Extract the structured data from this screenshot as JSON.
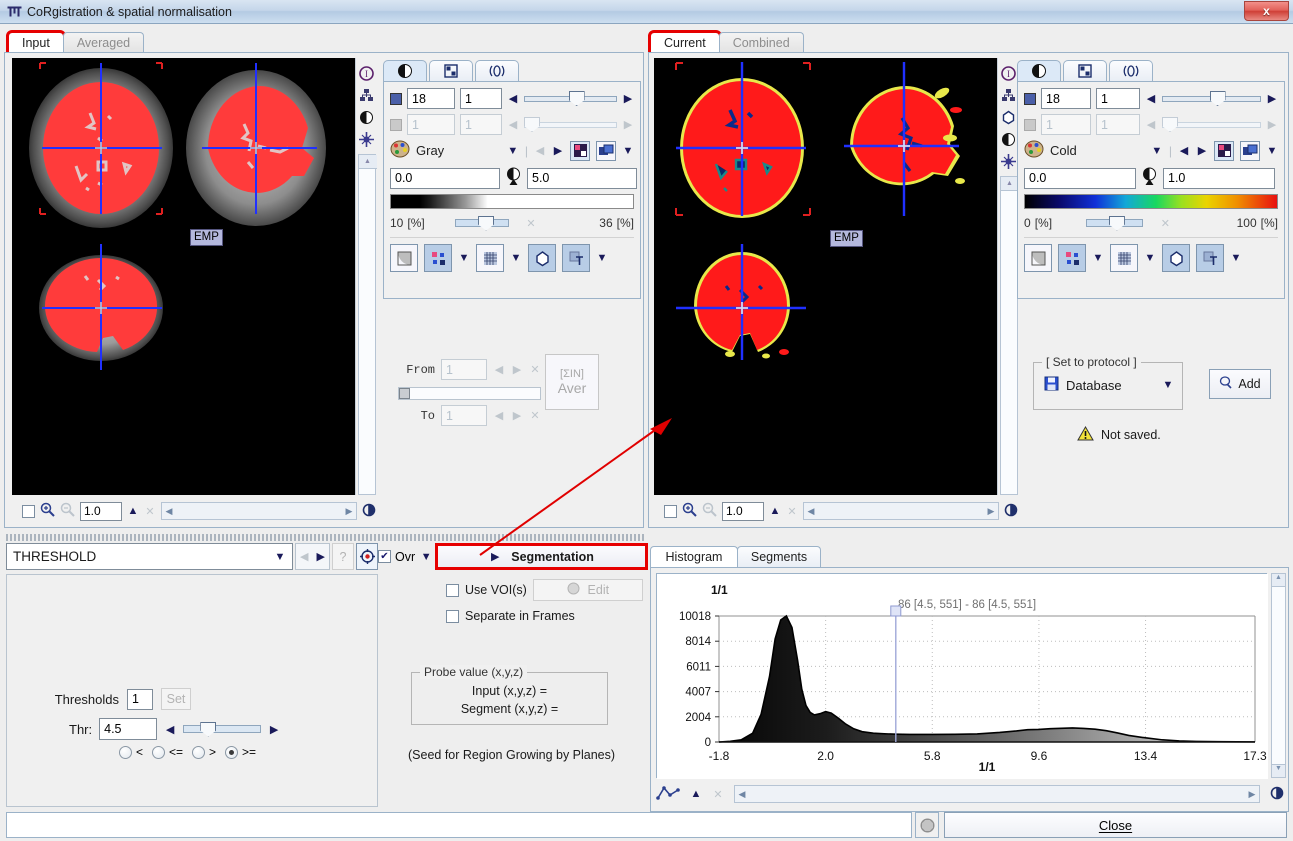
{
  "window": {
    "title": "CoRgistration & spatial normalisation",
    "close_label": "x",
    "app_icon": "corregistration-icon"
  },
  "left": {
    "tabs": [
      {
        "label": "Input",
        "selected": true
      },
      {
        "label": "Averaged",
        "selected": false
      }
    ],
    "viewer": {
      "overlay_label": "EMP",
      "toolbar_icons": [
        "info-icon",
        "layout-icon",
        "contrast-icon",
        "crosshair-icon"
      ],
      "zoom_value": "1.0",
      "checkbox_checked": false
    },
    "controls": {
      "tabs": [
        "contrast-tab",
        "layout-tab",
        "transform-tab"
      ],
      "slice_value": "18",
      "slice_frame": "1",
      "second_value": "1",
      "second_frame": "1",
      "lut_name": "Gray",
      "min_value": "0.0",
      "max_value": "5.0",
      "pct_min": "10",
      "pct_min_unit": "[%]",
      "pct_max": "36",
      "pct_max_unit": "[%]"
    },
    "aver": {
      "from_label": "From",
      "from_value": "1",
      "to_label": "To",
      "to_value": "1",
      "button_top": "[ΣIN]",
      "button_bottom": "Aver"
    }
  },
  "right": {
    "tabs": [
      {
        "label": "Current",
        "selected": true
      },
      {
        "label": "Combined",
        "selected": false
      }
    ],
    "viewer": {
      "overlay_label": "EMP",
      "toolbar_icons": [
        "info-icon",
        "layout-icon",
        "shape-icon",
        "contrast-icon",
        "crosshair-icon"
      ],
      "zoom_value": "1.0",
      "checkbox_checked": false
    },
    "controls": {
      "slice_value": "18",
      "slice_frame": "1",
      "second_value": "1",
      "second_frame": "1",
      "lut_name": "Cold",
      "min_value": "0.0",
      "max_value": "1.0",
      "pct_min": "0",
      "pct_min_unit": "[%]",
      "pct_max": "100",
      "pct_max_unit": "[%]"
    },
    "protocol": {
      "group_label": "[ Set to protocol ]",
      "select_value": "Database",
      "add_label": "Add",
      "status_text": "Not saved."
    }
  },
  "threshold_panel": {
    "method": "THRESHOLD",
    "help_label": "?",
    "target_icon": "target-icon",
    "thresholds_label": "Thresholds",
    "thresholds_value": "1",
    "set_label": "Set",
    "thr_label": "Thr:",
    "thr_value": "4.5",
    "operators": [
      {
        "label": "<",
        "selected": false
      },
      {
        "label": "<=",
        "selected": false
      },
      {
        "label": ">",
        "selected": false
      },
      {
        "label": ">=",
        "selected": true
      }
    ]
  },
  "segmentation_panel": {
    "ovr_label": "Ovr",
    "ovr_checked": true,
    "segmentation_label": "Segmentation",
    "use_vois_label": "Use VOI(s)",
    "use_vois_checked": false,
    "edit_label": "Edit",
    "separate_label": "Separate in Frames",
    "separate_checked": false,
    "probe_group_label": "Probe value (x,y,z)",
    "probe_input_label": "Input (x,y,z) =",
    "probe_segment_label": "Segment (x,y,z) =",
    "seed_note": "(Seed for Region Growing by Planes)"
  },
  "histogram_panel": {
    "tabs": [
      {
        "label": "Histogram",
        "selected": true
      },
      {
        "label": "Segments",
        "selected": false
      }
    ],
    "corner_label": "1/1",
    "cursor_label": "86 [4.5, 551] - 86 [4.5, 551]"
  },
  "footer": {
    "close_label": "Close",
    "stop_icon": "stop-icon"
  },
  "chart_data": {
    "type": "area",
    "title": "1/1",
    "xlabel": "1/1",
    "ylabel": "",
    "annotation": "86 [4.5, 551] - 86 [4.5, 551]",
    "xticks": [
      "-1.8",
      "2.0",
      "5.8",
      "9.6",
      "13.4",
      "17.3"
    ],
    "xtick_values": [
      -1.8,
      2.0,
      5.8,
      9.6,
      13.4,
      17.3
    ],
    "yticks": [
      "0",
      "2004",
      "4007",
      "6011",
      "8014",
      "10018"
    ],
    "ytick_values": [
      0,
      2004,
      4007,
      6011,
      8014,
      10018
    ],
    "xlim": [
      -1.8,
      17.3
    ],
    "ylim": [
      0,
      10018
    ],
    "grid": true,
    "cursor_x": 4.5,
    "x": [
      -1.8,
      -1.4,
      -1.0,
      -0.6,
      -0.3,
      0.0,
      0.2,
      0.4,
      0.6,
      0.8,
      1.0,
      1.15,
      1.3,
      1.45,
      1.6,
      1.8,
      2.0,
      2.2,
      2.45,
      2.7,
      3.0,
      3.3,
      3.7,
      4.1,
      4.5,
      5.0,
      5.8,
      6.6,
      7.4,
      8.2,
      8.8,
      9.2,
      9.6,
      10.0,
      10.4,
      10.8,
      11.2,
      11.6,
      12.0,
      12.4,
      12.8,
      13.4,
      14.0,
      14.6,
      15.2,
      16.0,
      17.3
    ],
    "values": [
      0,
      60,
      180,
      700,
      2200,
      5200,
      8200,
      9700,
      10018,
      9100,
      6500,
      4200,
      2900,
      2350,
      2150,
      2250,
      2420,
      2300,
      1900,
      1450,
      1050,
      820,
      700,
      650,
      620,
      600,
      600,
      610,
      640,
      760,
      880,
      980,
      1000,
      1060,
      1090,
      1120,
      1080,
      1020,
      900,
      720,
      520,
      330,
      170,
      90,
      50,
      25,
      10
    ]
  }
}
